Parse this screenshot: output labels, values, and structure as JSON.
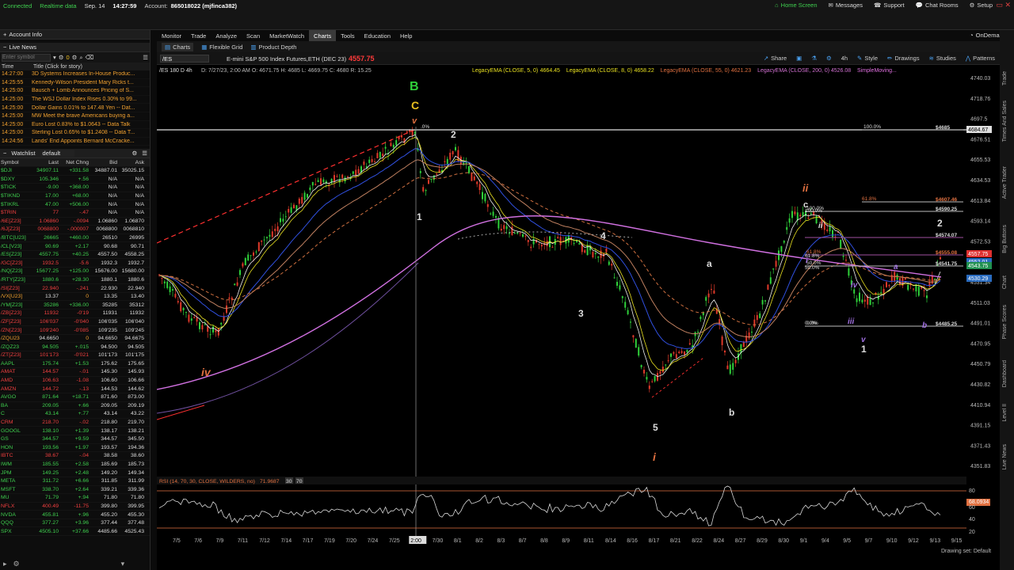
{
  "top": {
    "connected": "Connected",
    "realtime": "Realtime data",
    "datetime_label": "Sep. 14",
    "time": "14:27:59",
    "account_label": "Account:",
    "account": "865018022 (mjfinca382)",
    "home_screen": "Home Screen",
    "messages": "Messages",
    "support": "Support",
    "chat_rooms": "Chat Rooms",
    "setup": "Setup",
    "ondemand": "OnDemand"
  },
  "nav": [
    "Monitor",
    "Trade",
    "Analyze",
    "Scan",
    "MarketWatch",
    "Charts",
    "Tools",
    "Education",
    "Help"
  ],
  "left": {
    "account_info": "Account Info",
    "live_news": "Live News",
    "enter_symbol": "Enter symbol",
    "count": "0",
    "news_time_hdr": "Time",
    "news_title_hdr": "Title (Click for story)",
    "news": [
      {
        "t": "14:27:00",
        "h": "3D Systems Increases In-House Produc..."
      },
      {
        "t": "14:25:55",
        "h": "Kennedy-Wilson President Mary Ricks t..."
      },
      {
        "t": "14:25:00",
        "h": "Bausch + Lomb Announces Pricing of S..."
      },
      {
        "t": "14:25:00",
        "h": "The WSJ Dollar Index Rises 0.30% to 99..."
      },
      {
        "t": "14:25:00",
        "h": "Dollar Gains 0.01% to 147.48 Yen -- Dat..."
      },
      {
        "t": "14:25:00",
        "h": "MW Meet the brave Americans buying a..."
      },
      {
        "t": "14:25:00",
        "h": "Euro Lost 0.83% to $1.0643 -- Data Talk"
      },
      {
        "t": "14:25:00",
        "h": "Sterling Lost 0.65% to $1.2408 -- Data T..."
      },
      {
        "t": "14:24:56",
        "h": "Lands' End Appoints Bernard McCracke..."
      }
    ],
    "watchlist_label": "Watchlist",
    "watchlist_name": "default",
    "cols": [
      "Symbol",
      "Last",
      "Net Chng",
      "Bid",
      "Ask"
    ],
    "rows": [
      [
        "$DJI",
        "34907.11",
        "+331.58",
        "34887.01",
        "35025.15",
        "g"
      ],
      [
        "$DXY",
        "105.346",
        "+.56",
        "N/A",
        "N/A",
        "g"
      ],
      [
        "$TICK",
        "-9.00",
        "+368.00",
        "N/A",
        "N/A",
        "g"
      ],
      [
        "$TIKND",
        "17.00",
        "+68.00",
        "N/A",
        "N/A",
        "g"
      ],
      [
        "$TIKRL",
        "47.00",
        "+506.00",
        "N/A",
        "N/A",
        "g"
      ],
      [
        "$TRIN",
        "77",
        "-.47",
        "N/A",
        "N/A",
        "r"
      ],
      [
        "/6E[Z23]",
        "1.06860",
        "-.0094",
        "1.06860",
        "1.06870",
        "r"
      ],
      [
        "/6J[Z23]",
        "0068800",
        "-.000007",
        "0068800",
        "0068810",
        "r"
      ],
      [
        "/BTC[U23]",
        "26665",
        "+460.00",
        "26510",
        "26995",
        "g"
      ],
      [
        "/CL[V23]",
        "90.69",
        "+2.17",
        "90.68",
        "90.71",
        "g"
      ],
      [
        "/ES[Z23]",
        "4557.75",
        "+40.25",
        "4557.50",
        "4558.25",
        "g"
      ],
      [
        "/GC[Z23]",
        "1932.5",
        "-5.6",
        "1932.3",
        "1932.7",
        "r"
      ],
      [
        "/NQ[Z23]",
        "15677.25",
        "+125.00",
        "15676.00",
        "15680.00",
        "g"
      ],
      [
        "/RTY[Z23]",
        "1880.6",
        "+28.30",
        "1880.1",
        "1880.6",
        "g"
      ],
      [
        "/SI[Z23]",
        "22.940",
        "-.241",
        "22.930",
        "22.940",
        "r"
      ],
      [
        "/VX[U23]",
        "13.37",
        "0",
        "13.35",
        "13.40",
        "o"
      ],
      [
        "/YM[Z23]",
        "35286",
        "+336.00",
        "35285",
        "35312",
        "g"
      ],
      [
        "/ZB[Z23]",
        "11932",
        "-0'19",
        "11931",
        "11932",
        "r"
      ],
      [
        "/ZF[Z23]",
        "106'037",
        "-0'040",
        "106'035",
        "106'040",
        "r"
      ],
      [
        "/ZN[Z23]",
        "109'240",
        "-0'085",
        "109'235",
        "109'245",
        "r"
      ],
      [
        "/ZQU23",
        "94.6650",
        "0",
        "94.6650",
        "94.6675",
        "o"
      ],
      [
        "/ZQZ23",
        "94.505",
        "+.015",
        "94.500",
        "94.505",
        "g"
      ],
      [
        "/ZT[Z23]",
        "101'173",
        "-0'021",
        "101'173",
        "101'175",
        "r"
      ],
      [
        "AAPL",
        "175.74",
        "+1.53",
        "175.62",
        "175.65",
        "g"
      ],
      [
        "AMAT",
        "144.57",
        "-.01",
        "145.30",
        "145.93",
        "r"
      ],
      [
        "AMD",
        "106.63",
        "-1.08",
        "106.60",
        "106.66",
        "r"
      ],
      [
        "AMZN",
        "144.72",
        "-.13",
        "144.53",
        "144.62",
        "r"
      ],
      [
        "AVGO",
        "871.64",
        "+18.71",
        "871.60",
        "873.00",
        "g"
      ],
      [
        "BA",
        "209.05",
        "+.66",
        "209.05",
        "209.19",
        "g"
      ],
      [
        "C",
        "43.14",
        "+.77",
        "43.14",
        "43.22",
        "g"
      ],
      [
        "CRM",
        "218.70",
        "-.02",
        "218.80",
        "219.70",
        "r"
      ],
      [
        "GOOGL",
        "138.10",
        "+1.39",
        "138.17",
        "138.21",
        "g"
      ],
      [
        "GS",
        "344.57",
        "+9.59",
        "344.57",
        "345.50",
        "g"
      ],
      [
        "HON",
        "193.56",
        "+1.97",
        "193.57",
        "194.36",
        "g"
      ],
      [
        "IBTC",
        "38.67",
        "-.04",
        "38.58",
        "38.60",
        "r"
      ],
      [
        "IWM",
        "185.55",
        "+2.58",
        "185.69",
        "185.73",
        "g"
      ],
      [
        "JPM",
        "149.25",
        "+2.48",
        "149.20",
        "149.34",
        "g"
      ],
      [
        "META",
        "311.72",
        "+6.66",
        "311.85",
        "311.99",
        "g"
      ],
      [
        "MSFT",
        "338.70",
        "+2.64",
        "339.21",
        "339.36",
        "g"
      ],
      [
        "MU",
        "71.79",
        "+.94",
        "71.80",
        "71.80",
        "g"
      ],
      [
        "NFLX",
        "400.49",
        "-11.75",
        "399.80",
        "399.95",
        "r"
      ],
      [
        "NVDA",
        "455.81",
        "+.96",
        "455.20",
        "455.30",
        "g"
      ],
      [
        "QQQ",
        "377.27",
        "+3.96",
        "377.44",
        "377.48",
        "g"
      ],
      [
        "SPX",
        "4505.10",
        "+37.66",
        "4485.66",
        "4525.43",
        "g"
      ]
    ]
  },
  "chart": {
    "tab_charts": "Charts",
    "tab_flexgrid": "Flexible Grid",
    "tab_depth": "Product Depth",
    "symbol": "/ES",
    "description": "E-mini S&P 500 Index Futures,ETH (DEC 23)",
    "price": "4557.75",
    "share": "Share",
    "period": "4h",
    "style": "Style",
    "drawings": "Drawings",
    "studies": "Studies",
    "patterns": "Patterns",
    "ohlc_label": "/ES 180 D 4h",
    "ohlc": "D: 7/27/23, 2:00 AM   O: 4671.75   H: 4685   L: 4669.75   C: 4680   R: 15.25",
    "studies_line": [
      {
        "t": "LegacyEMA (CLOSE, 5, 0)",
        "v": "4664.45",
        "c": "#e8e020"
      },
      {
        "t": "LegacyEMA (CLOSE, 8, 0)",
        "v": "4658.22",
        "c": "#e8e020"
      },
      {
        "t": "LegacyEMA (CLOSE, 55, 0)",
        "v": "4621.23",
        "c": "#e07040"
      },
      {
        "t": "LegacyEMA (CLOSE, 200, 0)",
        "v": "4526.08",
        "c": "#d070d0"
      },
      {
        "t": "SimpleMoving...",
        "v": "",
        "c": "#e070e0"
      }
    ],
    "rsi_label": "RSI (14, 70, 30, CLOSE, WILDERS, no)",
    "rsi_val": "71.9687",
    "rsi_30": "30",
    "rsi_70": "70",
    "drawing_set": "Drawing set: Default",
    "y_ticks": [
      "4740.03",
      "4718.76",
      "4697.5",
      "4676.51",
      "4655.53",
      "4634.53",
      "4613.84",
      "4593.14",
      "4572.53",
      "4552.05",
      "4531.34",
      "4511.03",
      "4491.01",
      "4470.95",
      "4450.79",
      "4430.82",
      "4410.94",
      "4391.15",
      "4371.43",
      "4351.83"
    ],
    "x_ticks": [
      "7/5",
      "7/6",
      "7/9",
      "7/11",
      "7/12",
      "7/14",
      "7/17",
      "7/19",
      "7/20",
      "7/24",
      "7/25",
      "2:00",
      "7/30",
      "8/1",
      "8/2",
      "8/3",
      "8/7",
      "8/8",
      "8/9",
      "8/11",
      "8/14",
      "8/16",
      "8/17",
      "8/21",
      "8/22",
      "8/24",
      "8/27",
      "8/29",
      "8/30",
      "9/1",
      "9/4",
      "9/5",
      "9/7",
      "9/10",
      "9/12",
      "9/13",
      "9/15"
    ],
    "rsi_ticks": [
      "80",
      "68.0934",
      "60",
      "40",
      "20"
    ],
    "price_tags": [
      {
        "v": "4684.67",
        "c": "#e0e0e0"
      },
      {
        "v": "4557.75",
        "c": "#e03030"
      },
      {
        "v": "4552.01",
        "c": "#2a6cc0"
      },
      {
        "v": "4543.75",
        "c": "#209050"
      },
      {
        "v": "4530.29",
        "c": "#2a6cc0"
      }
    ],
    "fib": [
      {
        "lbl": "100.0%",
        "price": "$4685"
      },
      {
        "lbl": "61.8%",
        "price": "$4607.46"
      },
      {
        "lbl": "100.0%",
        "price": "$4590.25"
      },
      {
        "lbl": "",
        "price": "$4574.07"
      },
      {
        "lbl": "61.8%",
        "price": "$4555.08"
      },
      {
        "lbl": "50.0%",
        "price": "$4541.75"
      },
      {
        "lbl": "0.0%",
        "price": "$4485.25"
      }
    ],
    "wave_labels": {
      "B": "B",
      "C": "C",
      "v": "v",
      "one": "1",
      "two": "2",
      "three": "3",
      "four": "4",
      "five": "5",
      "a": "a",
      "b": "b",
      "i": "i",
      "ii": "ii",
      "iii": "iii",
      "iv": "iv",
      "c": "c",
      "two_b": "2",
      "one_b": "1"
    }
  },
  "right_tabs": [
    "Trade",
    "Times And Sales",
    "Active Trader",
    "Big Buttons",
    "Chart",
    "Phase Scores",
    "Dashboard",
    "Level II",
    "Live News"
  ]
}
